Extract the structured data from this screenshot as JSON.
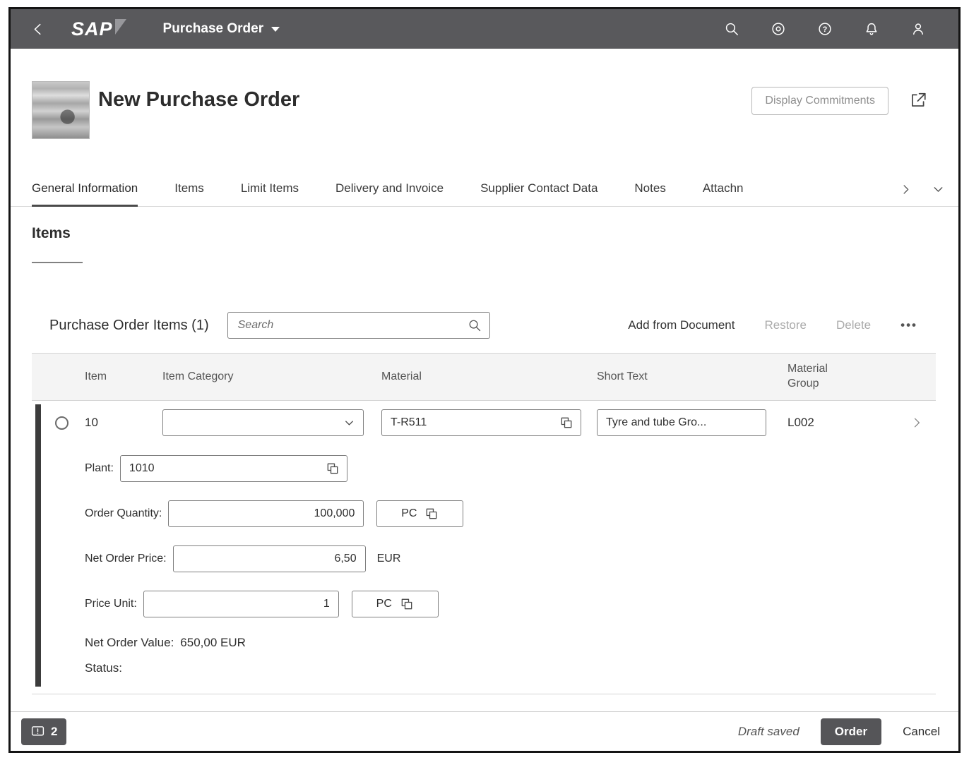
{
  "colors": {
    "shell_bg": "#59595c",
    "emphasized_button_bg": "#555558",
    "selected_tab_underline": "#4a4a4a",
    "table_header_bg": "#f4f4f4"
  },
  "shell": {
    "logo": "SAP",
    "title": "Purchase Order"
  },
  "icons": {
    "shell": [
      "search-icon",
      "copilot-icon",
      "help-icon",
      "notifications-icon",
      "profile-icon"
    ],
    "page_header": [
      "share-icon"
    ],
    "inputs": [
      "value-help-icon",
      "chevron-down-icon"
    ],
    "footer": [
      "message-popover-icon"
    ]
  },
  "page_header": {
    "title": "New Purchase Order",
    "display_commitments_label": "Display Commitments"
  },
  "tabs": [
    {
      "label": "General Information",
      "selected": true
    },
    {
      "label": "Items",
      "selected": false
    },
    {
      "label": "Limit Items",
      "selected": false
    },
    {
      "label": "Delivery and Invoice",
      "selected": false
    },
    {
      "label": "Supplier Contact Data",
      "selected": false
    },
    {
      "label": "Notes",
      "selected": false
    },
    {
      "label": "Attachn",
      "selected": false
    }
  ],
  "section": {
    "title": "Items"
  },
  "items_toolbar": {
    "title": "Purchase Order Items (1)",
    "search_placeholder": "Search",
    "add_from_document_label": "Add from Document",
    "restore_label": "Restore",
    "delete_label": "Delete",
    "overflow_label": "•••"
  },
  "table": {
    "columns": [
      "Item",
      "Item Category",
      "Material",
      "Short Text",
      "Material Group"
    ],
    "row": {
      "item": "10",
      "item_category": "",
      "material": "T-R511",
      "short_text": "Tyre and tube Gro...",
      "material_group": "L002"
    },
    "details": {
      "plant_label": "Plant:",
      "plant_value": "1010",
      "order_quantity_label": "Order Quantity:",
      "order_quantity_value": "100,000",
      "order_quantity_unit": "PC",
      "net_order_price_label": "Net Order Price:",
      "net_order_price_value": "6,50",
      "net_order_price_currency": "EUR",
      "price_unit_label": "Price Unit:",
      "price_unit_value": "1",
      "price_unit_unit": "PC",
      "net_order_value_label": "Net Order Value:",
      "net_order_value_text": "650,00  EUR",
      "status_label": "Status:"
    }
  },
  "footer": {
    "messages_count": "2",
    "draft_status": "Draft saved",
    "order_label": "Order",
    "cancel_label": "Cancel"
  }
}
